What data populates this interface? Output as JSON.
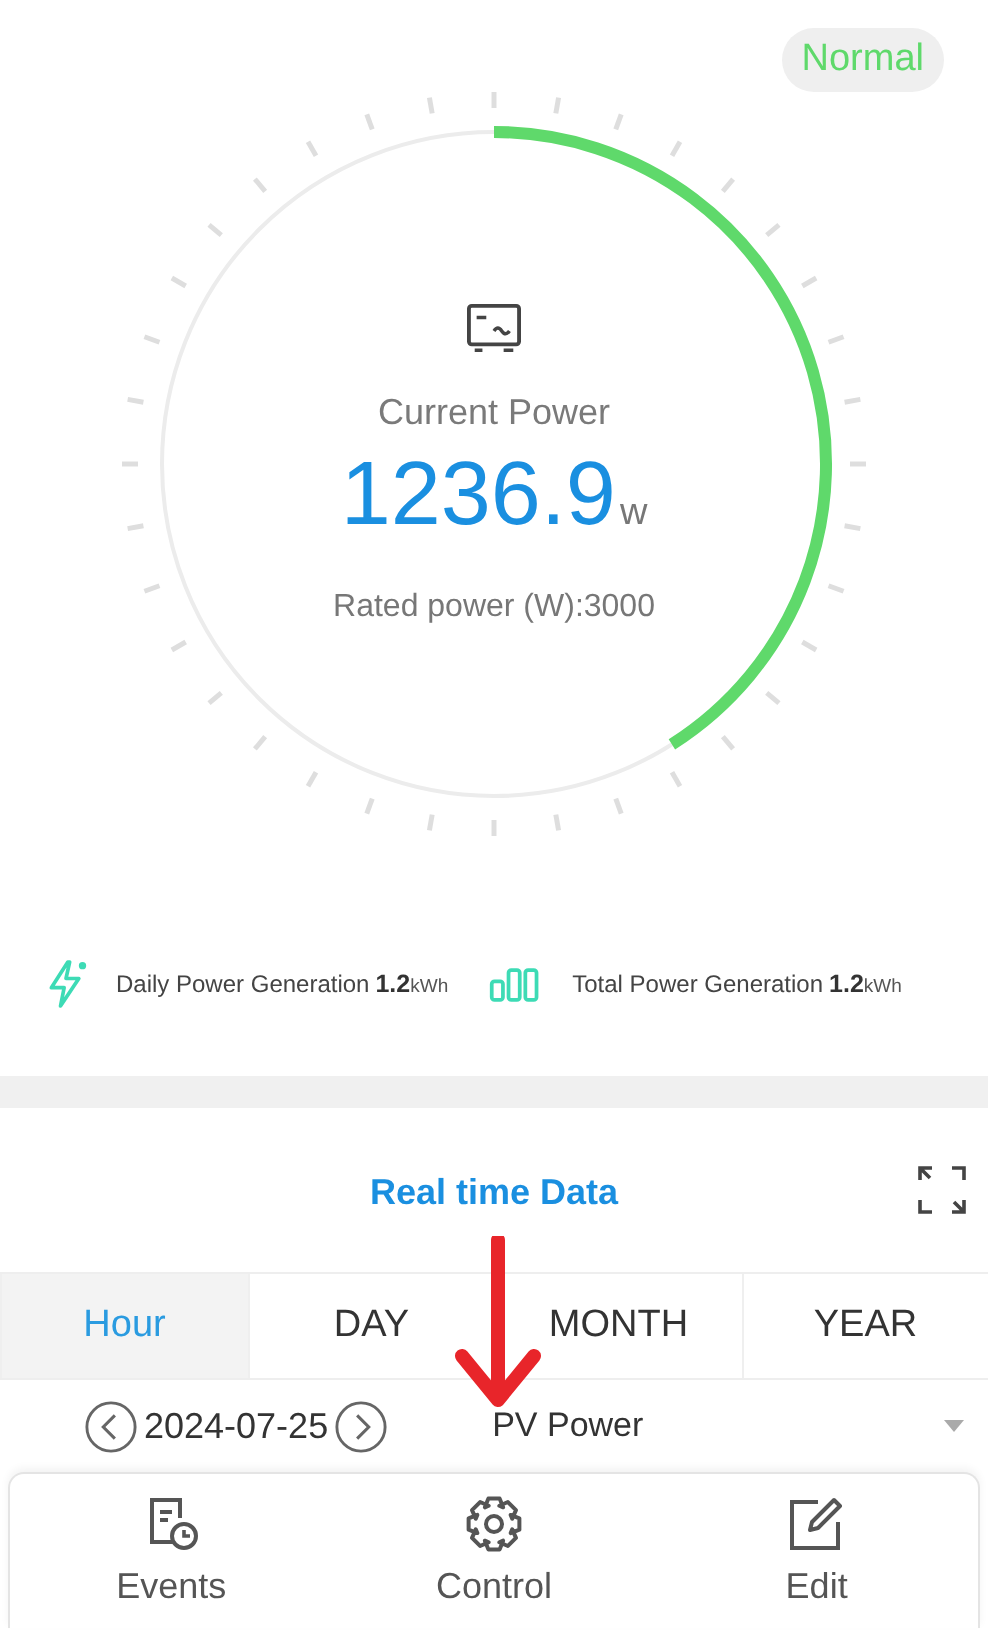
{
  "status_badge": "Normal",
  "gauge": {
    "title": "Current Power",
    "value": "1236.9",
    "unit": "w",
    "rated": "Rated power (W):3000"
  },
  "stats": [
    {
      "kind": "daily",
      "label": "Daily Power Generation",
      "value": "1.2",
      "unit": "kWh"
    },
    {
      "kind": "total",
      "label": "Total Power Generation",
      "value": "1.2",
      "unit": "kWh"
    }
  ],
  "section_title": "Real time Data",
  "tabs": [
    {
      "label": "Hour",
      "selected": true
    },
    {
      "label": "DAY",
      "selected": false
    },
    {
      "label": "MONTH",
      "selected": false
    },
    {
      "label": "YEAR",
      "selected": false
    }
  ],
  "date": "2024-07-25",
  "metric": "PV Power",
  "nav": [
    {
      "kind": "events",
      "label": "Events"
    },
    {
      "kind": "control",
      "label": "Control"
    },
    {
      "kind": "edit",
      "label": "Edit"
    }
  ],
  "annotation": {
    "kind": "arrow"
  }
}
